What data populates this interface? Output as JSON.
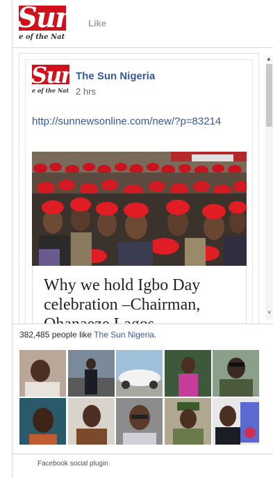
{
  "header": {
    "page_logo": "The Sun logo",
    "logo_text": "Sun",
    "motto_text": "e of the Nat",
    "like_label": "Like"
  },
  "post": {
    "page_name": "The Sun Nigeria",
    "time": "2 hrs",
    "link": "http://sunnewsonline.com/new/?p=83214",
    "avatar_text": "Sun",
    "avatar_motto": "e of the Nat",
    "headline": "Why we hold Igbo Day celebration –Chairman, Ohanaeze Lagos"
  },
  "fans": {
    "count_text": "382,485 people like ",
    "page_link": "The Sun Nigeria",
    "suffix": "."
  },
  "footer": {
    "label": "Facebook social plugin"
  },
  "colors": {
    "link": "#365899",
    "brand_red": "#d0101a",
    "border": "#d3d6db"
  }
}
